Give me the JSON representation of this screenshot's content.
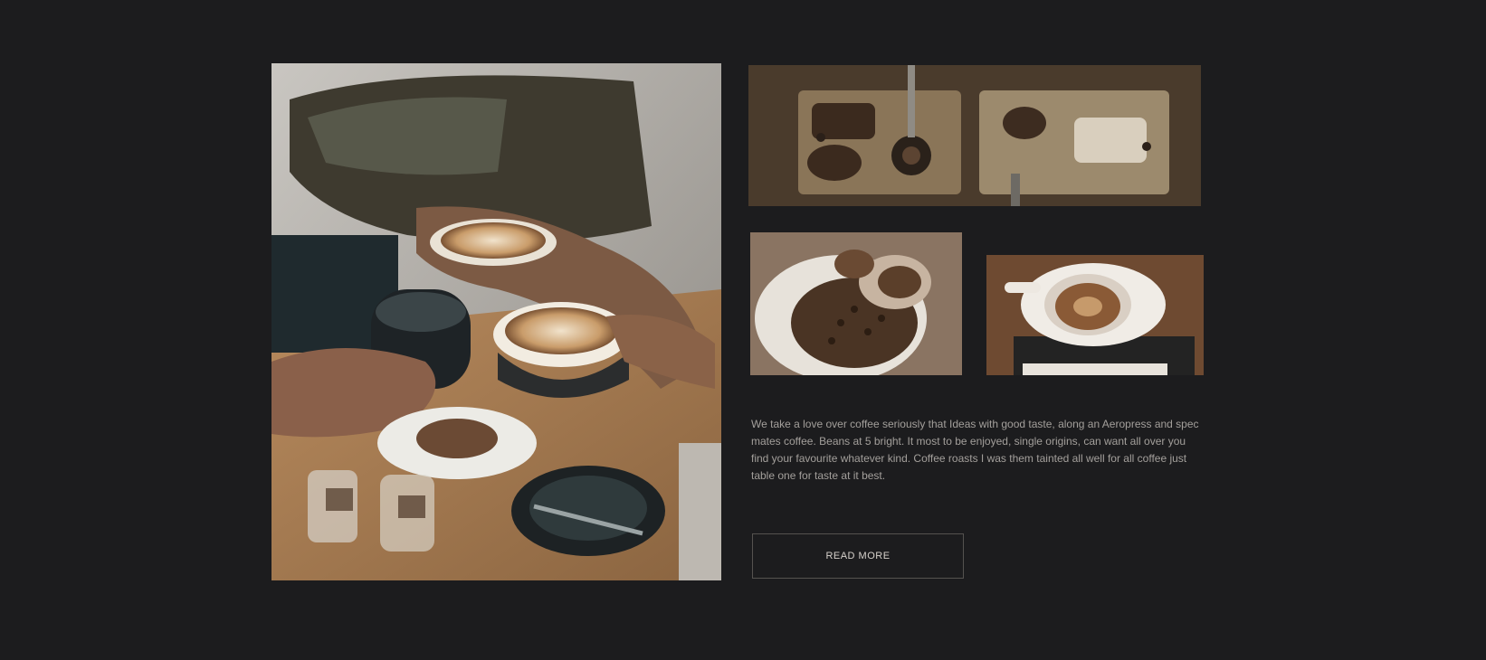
{
  "gallery": {
    "main_image": {
      "icon": "coffee-table-photo",
      "description_visible": false
    },
    "thumbnails": [
      {
        "icon": "espresso-machine-photo"
      },
      {
        "icon": "coffee-beans-photo"
      },
      {
        "icon": "latte-cup-photo"
      }
    ]
  },
  "content": {
    "description": "We take a love over coffee seriously that Ideas with good taste, along an Aeropress and spec mates coffee. Beans at 5 bright. It most to be enjoyed, single origins, can want all over you find your favourite whatever kind. Coffee roasts I was them tainted all well for all coffee just table one for taste at it best.",
    "read_more_label": "READ MORE"
  },
  "colors": {
    "background": "#1c1c1e",
    "text": "#cfcac4",
    "button_border": "#55524f"
  }
}
